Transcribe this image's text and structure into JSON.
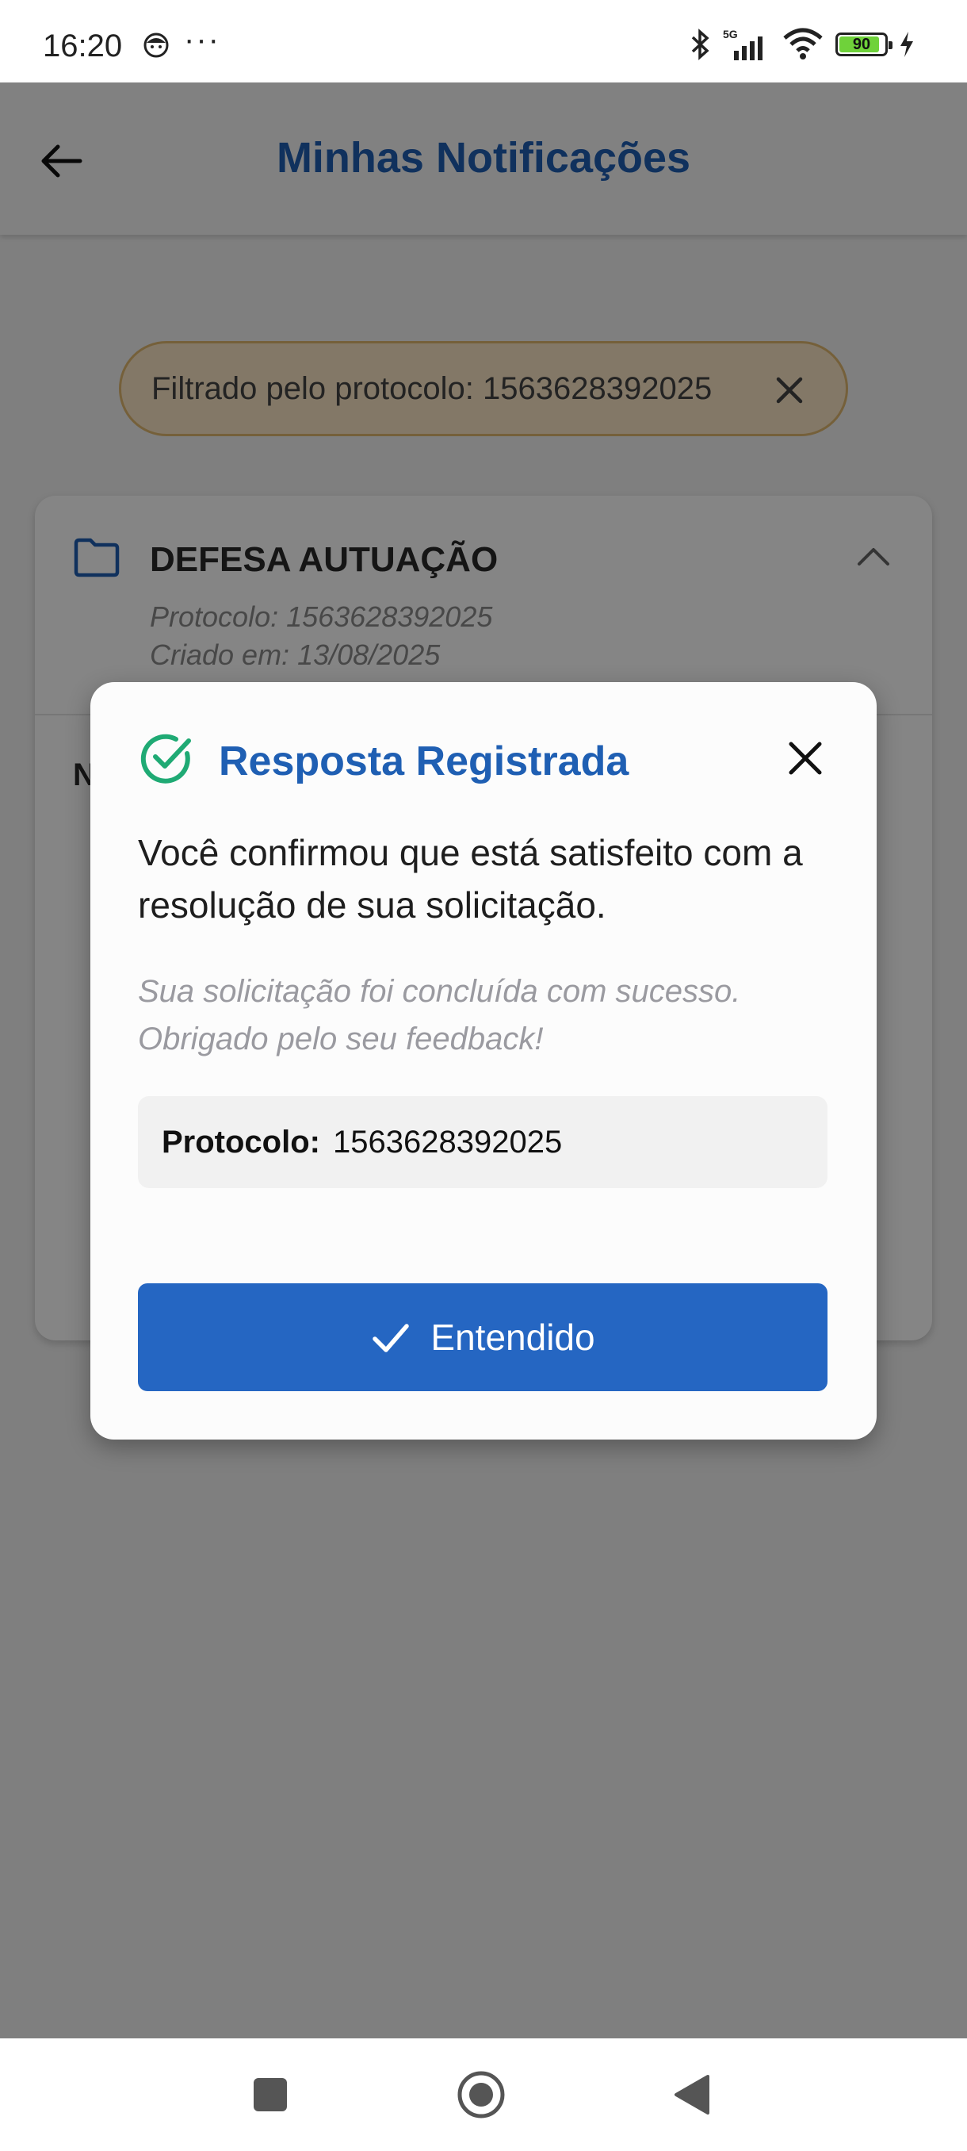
{
  "status_bar": {
    "time": "16:20",
    "notification_dots": "···",
    "network_label": "5G",
    "battery_level": "90",
    "battery_fraction": 0.9
  },
  "app_bar": {
    "title": "Minhas Notificações"
  },
  "filter_chip": {
    "text": "Filtrado pelo protocolo: 1563628392025"
  },
  "card": {
    "title": "DEFESA AUTUAÇÃO",
    "protocol": "Protocolo: 1563628392025",
    "created": "Criado em: 13/08/2025",
    "body_partial": "N"
  },
  "dialog": {
    "title": "Resposta Registrada",
    "message": "Você confirmou que está satisfeito com a resolução de sua solicitação.",
    "subtitle": "Sua solicitação foi concluída com sucesso. Obrigado pelo seu feedback!",
    "protocol_label": "Protocolo:",
    "protocol_value": "1563628392025",
    "button_label": "Entendido"
  },
  "colors": {
    "primary": "#1f5fb3",
    "button": "#2566c2",
    "success": "#1faa74",
    "chip_bg": "#fbe6c6",
    "chip_border": "#e0b870"
  },
  "icons": [
    "back-arrow-icon",
    "close-icon",
    "folder-icon",
    "chevron-up-icon",
    "check-circle-icon",
    "check-icon",
    "square-icon",
    "home-circle-icon",
    "back-triangle-icon"
  ]
}
